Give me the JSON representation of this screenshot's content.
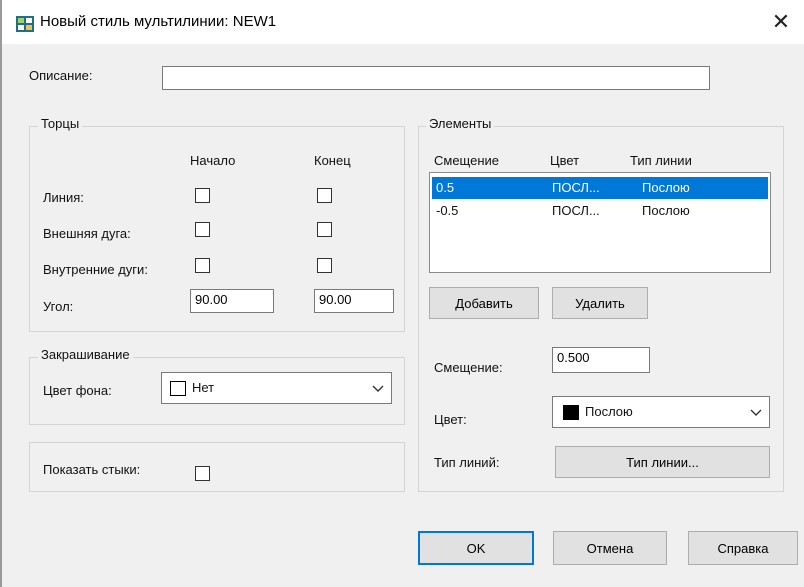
{
  "window": {
    "title": "Новый стиль мультилинии: NEW1",
    "close_glyph": "✕",
    "icon": "multiline-style-icon"
  },
  "description": {
    "label": "Описание:",
    "value": ""
  },
  "caps": {
    "group_title": "Торцы",
    "col_start": "Начало",
    "col_end": "Конец",
    "rows": [
      {
        "label": "Линия:",
        "start_checked": false,
        "end_checked": false
      },
      {
        "label": "Внешняя дуга:",
        "start_checked": false,
        "end_checked": false
      },
      {
        "label": "Внутренние дуги:",
        "start_checked": false,
        "end_checked": false
      }
    ],
    "angle_label": "Угол:",
    "angle_start": "90.00",
    "angle_end": "90.00"
  },
  "fill": {
    "group_title": "Закрашивание",
    "color_label": "Цвет фона:",
    "color_value": "Нет",
    "swatch_color": "#ffffff"
  },
  "joints": {
    "label": "Показать стыки:",
    "checked": false
  },
  "elements": {
    "group_title": "Элементы",
    "headers": [
      "Смещение",
      "Цвет",
      "Тип линии"
    ],
    "rows": [
      {
        "offset": "0.5",
        "color": "ПОСЛ...",
        "linetype": "Послою",
        "selected": true
      },
      {
        "offset": "-0.5",
        "color": "ПОСЛ...",
        "linetype": "Послою",
        "selected": false
      }
    ],
    "add_label": "Добавить",
    "delete_label": "Удалить",
    "offset_label": "Смещение:",
    "offset_value": "0.500",
    "color_label": "Цвет:",
    "color_value": "Послою",
    "color_swatch": "#000000",
    "linetype_label": "Тип линий:",
    "linetype_button": "Тип линии..."
  },
  "footer": {
    "ok_label": "OK",
    "cancel_label": "Отмена",
    "help_label": "Справка"
  },
  "colors": {
    "accent": "#0078d7",
    "dialog_bg": "#f0f0f0"
  }
}
